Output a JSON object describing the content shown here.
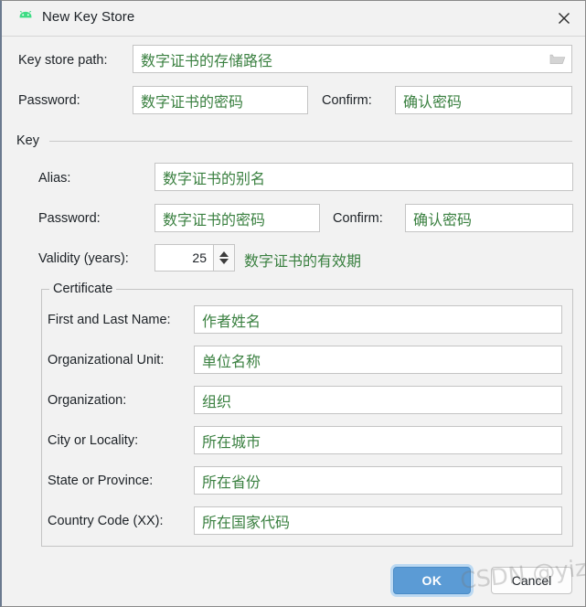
{
  "window": {
    "title": "New Key Store",
    "app_icon": "android-robot-icon",
    "close_icon": "close-icon",
    "accent_color": "#5b9bd5",
    "value_text_color": "#3a8040"
  },
  "keystore": {
    "path_label": "Key store path:",
    "path_value": "数字证书的存储路径",
    "browse_icon": "folder-icon",
    "password_label": "Password:",
    "password_value": "数字证书的密码",
    "confirm_label": "Confirm:",
    "confirm_value": "确认密码"
  },
  "key_section": {
    "title": "Key",
    "alias_label": "Alias:",
    "alias_value": "数字证书的别名",
    "password_label": "Password:",
    "password_value": "数字证书的密码",
    "confirm_label": "Confirm:",
    "confirm_value": "确认密码",
    "validity_label": "Validity (years):",
    "validity_value": "25",
    "validity_hint": "数字证书的有效期"
  },
  "certificate": {
    "title": "Certificate",
    "fields": [
      {
        "label": "First and Last Name:",
        "value": "作者姓名"
      },
      {
        "label": "Organizational Unit:",
        "value": "单位名称"
      },
      {
        "label": "Organization:",
        "value": "组织"
      },
      {
        "label": "City or Locality:",
        "value": "所在城市"
      },
      {
        "label": "State or Province:",
        "value": "所在省份"
      },
      {
        "label": "Country Code (XX):",
        "value": "所在国家代码"
      }
    ]
  },
  "buttons": {
    "ok": "OK",
    "cancel": "Cancel"
  },
  "watermark": {
    "text": "CSDN @yizai()"
  }
}
